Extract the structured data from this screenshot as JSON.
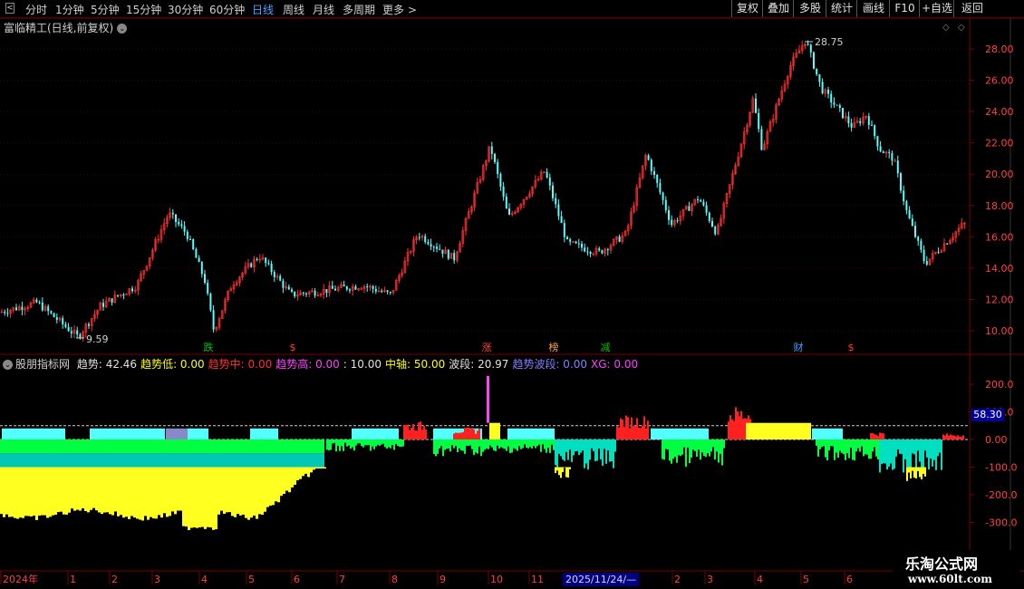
{
  "toolbar": {
    "tabs": [
      "分时",
      "1分钟",
      "5分钟",
      "15分钟",
      "30分钟",
      "60分钟",
      "日线",
      "周线",
      "月线",
      "多周期",
      "更多 >"
    ],
    "active_tab": "日线",
    "right_buttons": [
      "复权",
      "叠加",
      "多股",
      "统计",
      "画线",
      "F10",
      "+自选",
      "返回"
    ]
  },
  "main_chart": {
    "title": "富临精工(日线,前复权)",
    "high_label": "28.75",
    "low_label": "9.59",
    "y_ticks": [
      "28.00",
      "26.00",
      "24.00",
      "22.00",
      "20.00",
      "18.00",
      "16.00",
      "14.00",
      "12.00",
      "10.00"
    ],
    "event_markers": [
      {
        "text": "跌",
        "color": "#00c000"
      },
      {
        "text": "$",
        "color": "#ff4040"
      },
      {
        "text": "涨",
        "color": "#ff4040"
      },
      {
        "text": "榜",
        "color": "#ffa040"
      },
      {
        "text": "减",
        "color": "#00c000"
      },
      {
        "text": "财",
        "color": "#40a0ff"
      },
      {
        "text": "$",
        "color": "#ff4040"
      }
    ],
    "colors": {
      "up": "#ff3030",
      "down": "#54ffff",
      "grid": "#5a0000"
    }
  },
  "indicator": {
    "name": "股朋指标网",
    "fields": [
      {
        "label": "趋势:",
        "value": "42.46",
        "color": "#e0e0e0"
      },
      {
        "label": "趋势低:",
        "value": "0.00",
        "color": "#ffff00"
      },
      {
        "label": "趋势中:",
        "value": "0.00",
        "color": "#ff3030"
      },
      {
        "label": "趋势高:",
        "value": "0.00",
        "color": "#ff40ff"
      },
      {
        "label": ":",
        "value": "10.00",
        "color": "#e0e0e0"
      },
      {
        "label": "中轴:",
        "value": "50.00",
        "color": "#ffff00"
      },
      {
        "label": "波段:",
        "value": "20.97",
        "color": "#e0e0e0"
      },
      {
        "label": "趋势波段:",
        "value": "0.00",
        "color": "#8080ff"
      },
      {
        "label": "XG:",
        "value": "0.00",
        "color": "#ff40ff"
      }
    ],
    "y_ticks": [
      "200.0",
      "100.0",
      "0.00",
      "-100.0",
      "-200.0",
      "-300.0"
    ],
    "current_value": "58.30"
  },
  "time_axis": {
    "labels": [
      "2024年",
      "1",
      "2",
      "3",
      "4",
      "5",
      "6",
      "7",
      "8",
      "9",
      "10",
      "11",
      "2",
      "3",
      "4",
      "5",
      "6"
    ],
    "cursor_date": "2025/11/24/—"
  },
  "watermark": {
    "line1": "乐淘公式网",
    "line2": "www.60lt.com"
  }
}
